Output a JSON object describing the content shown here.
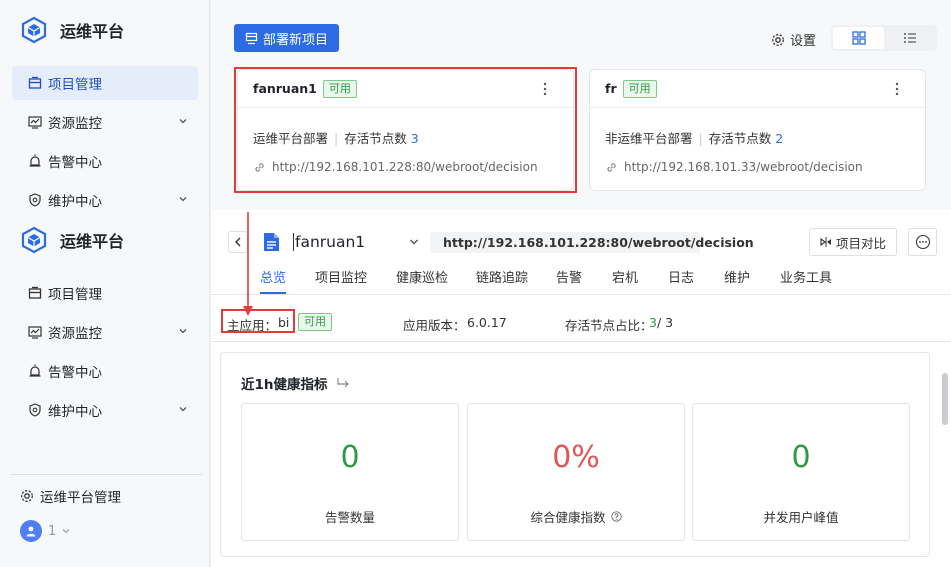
{
  "app": {
    "title": "运维平台"
  },
  "sidebar": {
    "items_top": [
      {
        "label": "项目管理",
        "icon": "project-icon",
        "active": true
      },
      {
        "label": "资源监控",
        "icon": "monitor-icon",
        "expandable": true
      },
      {
        "label": "告警中心",
        "icon": "alarm-icon"
      },
      {
        "label": "维护中心",
        "icon": "maintenance-icon",
        "expandable": true
      }
    ],
    "items_bottom": [
      {
        "label": "项目管理",
        "icon": "project-icon"
      },
      {
        "label": "资源监控",
        "icon": "monitor-icon",
        "expandable": true
      },
      {
        "label": "告警中心",
        "icon": "alarm-icon"
      },
      {
        "label": "维护中心",
        "icon": "maintenance-icon",
        "expandable": true
      }
    ],
    "footer": {
      "admin_label": "运维平台管理",
      "user": "1"
    }
  },
  "toolbar": {
    "deploy_label": "部署新项目",
    "settings_label": "设置"
  },
  "cards": [
    {
      "name": "fanruan1",
      "status": "可用",
      "desc": "运维平台部署",
      "nodes_label": "存活节点数",
      "nodes": "3",
      "url": "http://192.168.101.228:80/webroot/decision"
    },
    {
      "name": "fr",
      "status": "可用",
      "desc": "非运维平台部署",
      "nodes_label": "存活节点数",
      "nodes": "2",
      "url": "http://192.168.101.33/webroot/decision"
    }
  ],
  "detail": {
    "project": "fanruan1",
    "url": "http://192.168.101.228:80/webroot/decision",
    "compare_label": "项目对比",
    "tabs": [
      "总览",
      "项目监控",
      "健康巡检",
      "链路追踪",
      "告警",
      "宕机",
      "日志",
      "维护",
      "业务工具"
    ],
    "active_tab": "总览",
    "info": {
      "main_app_label": "主应用：",
      "main_app": "bi",
      "status": "可用",
      "version_label": "应用版本：",
      "version": "6.0.17",
      "ratio_label": "存活节点占比：",
      "ratio_alive": "3",
      "ratio_total": "/ 3"
    },
    "health": {
      "title": "近1h健康指标",
      "metrics": [
        {
          "value": "0",
          "label": "告警数量",
          "color": "#2e9a44"
        },
        {
          "value": "0%",
          "label": "综合健康指数",
          "color": "#e05555",
          "help": true
        },
        {
          "value": "0",
          "label": "并发用户峰值",
          "color": "#2e9a44"
        }
      ]
    }
  },
  "colors": {
    "primary": "#2d6be4",
    "success": "#2e9a44",
    "danger": "#e05555",
    "highlight": "#e03c3c"
  }
}
